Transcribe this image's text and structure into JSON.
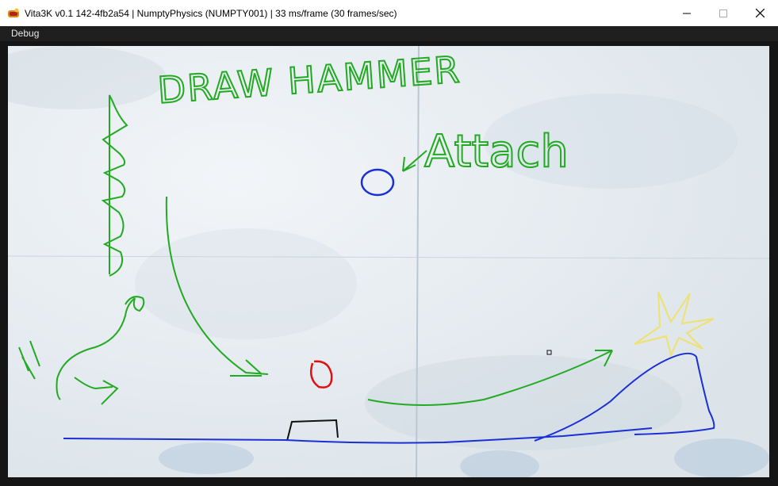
{
  "window": {
    "title": "Vita3K v0.1 142-4fb2a54 | NumptyPhysics (NUMPTY001) | 33 ms/frame (30 frames/sec)",
    "app_icon": "vita3k-icon"
  },
  "menu": {
    "items": [
      {
        "label": "Debug"
      }
    ]
  },
  "controls": {
    "minimize": "minimize-icon",
    "maximize": "maximize-icon",
    "close": "close-icon"
  },
  "game": {
    "level_hint_1": "DRAW HAMMER",
    "level_hint_2": "Attach",
    "colors": {
      "paper": "#e8eef3",
      "green_stroke": "#22aa22",
      "blue_stroke": "#1a2fd6",
      "red_ball": "#e01010",
      "yellow_star": "#f0e060",
      "black_object": "#111111"
    }
  }
}
